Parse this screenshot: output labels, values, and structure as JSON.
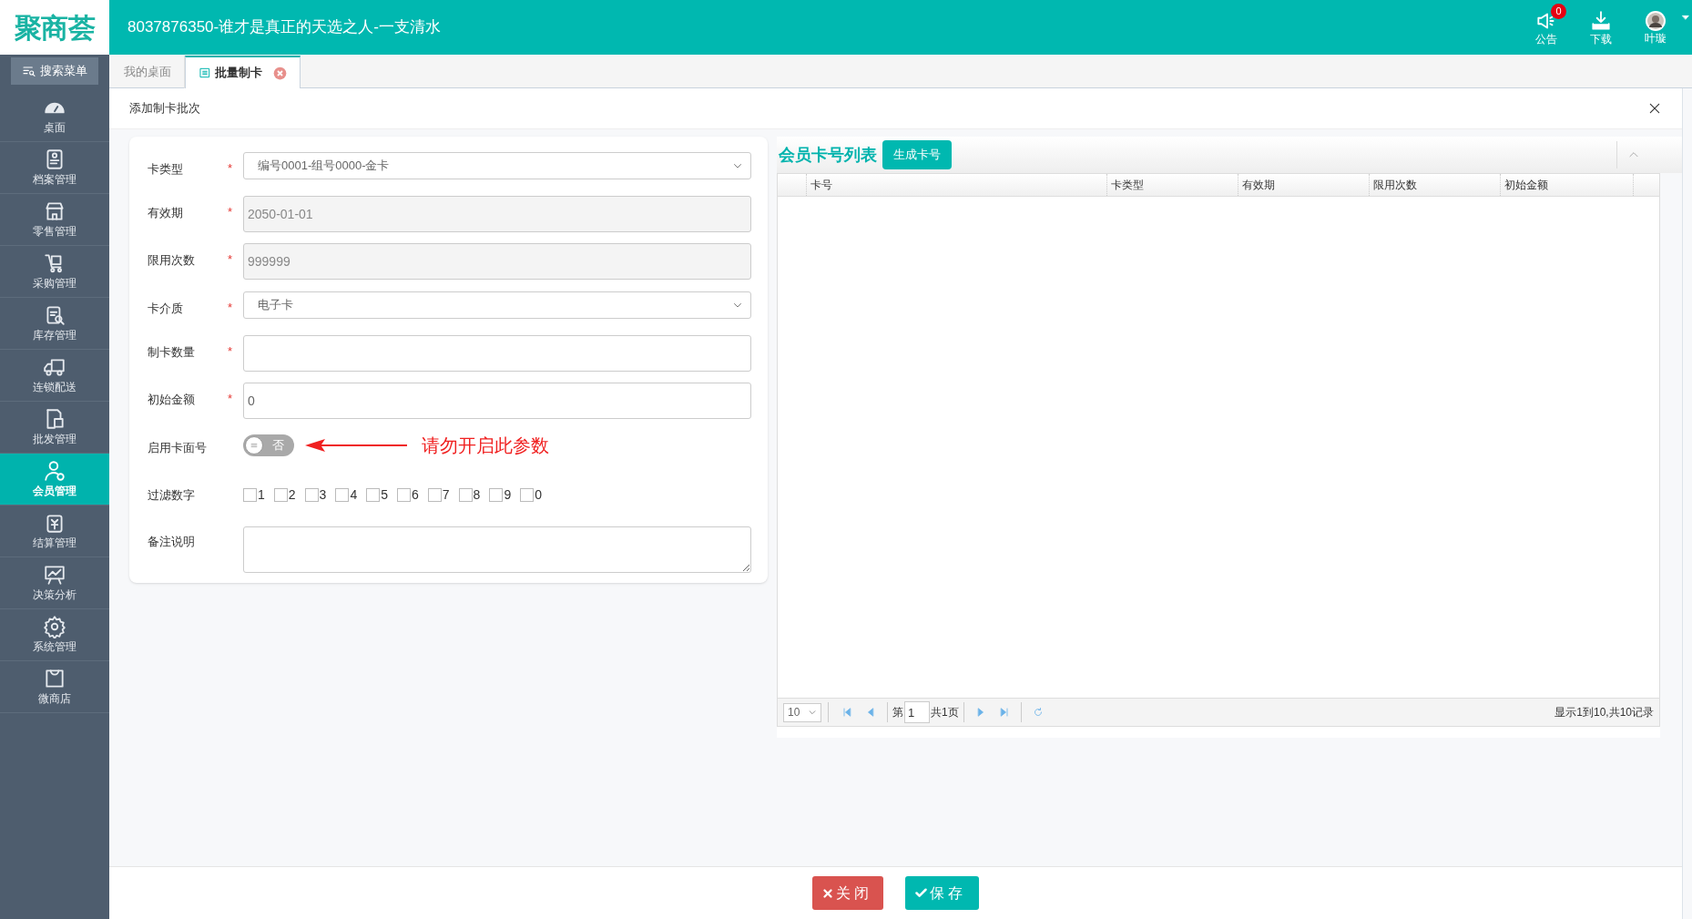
{
  "header": {
    "logo": "聚商荟",
    "title": "8037876350-谁才是真正的天选之人-一支清水",
    "notice": {
      "label": "公告",
      "badge": "0"
    },
    "download": {
      "label": "下载"
    },
    "user": {
      "name": "叶璇"
    }
  },
  "sidebar": {
    "search": "搜索菜单",
    "items": [
      {
        "label": "桌面",
        "selected": false
      },
      {
        "label": "档案管理",
        "selected": false
      },
      {
        "label": "零售管理",
        "selected": false
      },
      {
        "label": "采购管理",
        "selected": false
      },
      {
        "label": "库存管理",
        "selected": false
      },
      {
        "label": "连锁配送",
        "selected": false
      },
      {
        "label": "批发管理",
        "selected": false
      },
      {
        "label": "会员管理",
        "selected": true
      },
      {
        "label": "结算管理",
        "selected": false
      },
      {
        "label": "决策分析",
        "selected": false
      },
      {
        "label": "系统管理",
        "selected": false
      },
      {
        "label": "微商店",
        "selected": false
      }
    ]
  },
  "tabs": [
    {
      "label": "我的桌面",
      "selected": false,
      "closable": false
    },
    {
      "label": "批量制卡",
      "selected": true,
      "closable": true
    }
  ],
  "dialog": {
    "title": "添加制卡批次",
    "fields": [
      {
        "kind": "select",
        "label": "卡类型",
        "required_mark": "*",
        "value": "编号0001-组号0000-金卡"
      },
      {
        "kind": "input",
        "label": "有效期",
        "required_mark": "*",
        "value": "2050-01-01",
        "disabled": true
      },
      {
        "kind": "input",
        "label": "限用次数",
        "required_mark": "*",
        "value": "999999",
        "disabled": true
      },
      {
        "kind": "select",
        "label": "卡介质",
        "required_mark": "*",
        "value": "电子卡"
      },
      {
        "kind": "input",
        "label": "制卡数量",
        "required_mark": "*"
      },
      {
        "kind": "input",
        "label": "初始金额",
        "required_mark": "*",
        "value": "0"
      },
      {
        "kind": "toggle",
        "label": "启用卡面号",
        "on": false,
        "state_label": "否",
        "note": "请勿开启此参数"
      },
      {
        "kind": "checkboxes",
        "label": "过滤数字",
        "options": [
          {
            "label": "1",
            "checked": false
          },
          {
            "label": "2",
            "checked": false
          },
          {
            "label": "3",
            "checked": false
          },
          {
            "label": "4",
            "checked": false
          },
          {
            "label": "5",
            "checked": false
          },
          {
            "label": "6",
            "checked": false
          },
          {
            "label": "7",
            "checked": false
          },
          {
            "label": "8",
            "checked": false
          },
          {
            "label": "9",
            "checked": false
          },
          {
            "label": "0",
            "checked": false
          }
        ]
      },
      {
        "kind": "textarea",
        "label": "备注说明"
      }
    ],
    "card_list": {
      "title": "会员卡号列表",
      "generate_button": "生成卡号",
      "columns": [
        "卡号",
        "卡类型",
        "有效期",
        "限用次数",
        "初始金额"
      ],
      "pager": {
        "page_size": "10",
        "page_prefix": "第",
        "page": "1",
        "total": "共1页",
        "summary": "显示1到10,共10记录"
      }
    },
    "buttons": [
      {
        "kind": "close",
        "label": "关闭"
      },
      {
        "kind": "save",
        "label": "保存"
      }
    ]
  }
}
